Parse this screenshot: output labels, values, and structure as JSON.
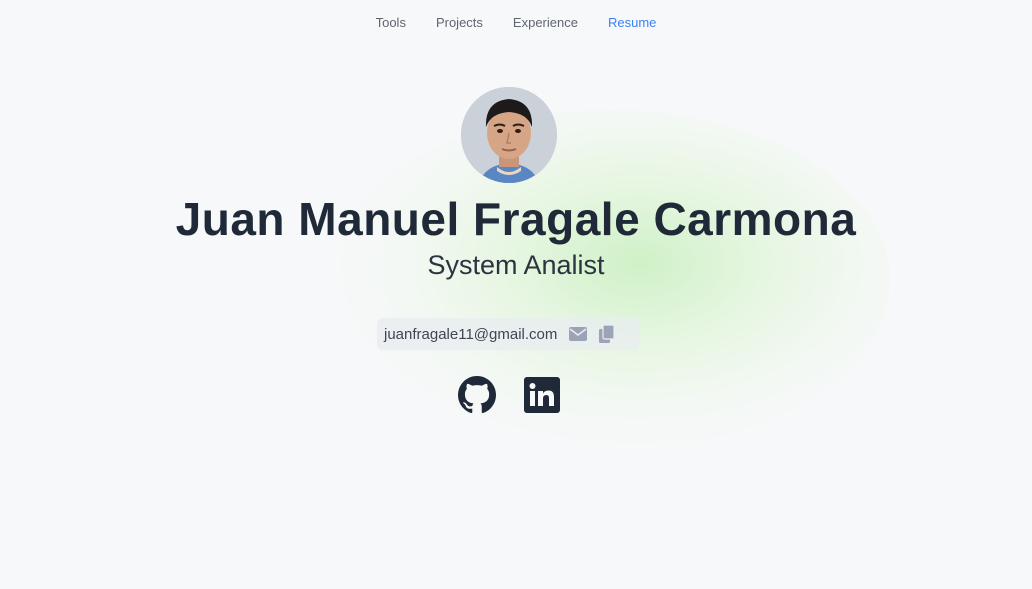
{
  "nav": {
    "items": [
      {
        "label": "Tools"
      },
      {
        "label": "Projects"
      },
      {
        "label": "Experience"
      },
      {
        "label": "Resume"
      }
    ],
    "active_color": "#3b82f6"
  },
  "profile": {
    "name": "Juan Manuel Fragale Carmona",
    "role": "System Analist",
    "email": "juanfragale11@gmail.com"
  },
  "icons": {
    "mail": "mail-icon",
    "copy": "copy-icon",
    "github": "github-icon",
    "linkedin": "linkedin-icon"
  },
  "colors": {
    "text_dark": "#1f2937",
    "icon_muted": "#9aa4b6",
    "glow": "#c8f0be"
  }
}
